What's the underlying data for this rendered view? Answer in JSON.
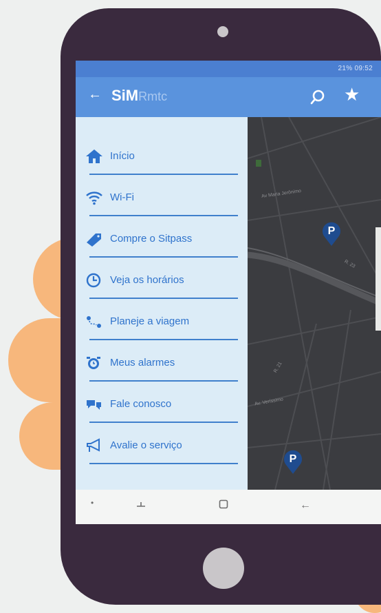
{
  "status_bar": {
    "text": "21% 09:52"
  },
  "app": {
    "logo_main": "SiM",
    "logo_sub": "Rmtc"
  },
  "icons": {
    "back": "back-arrow-icon",
    "search": "search-icon",
    "favorite": "star-icon"
  },
  "drawer": {
    "items": [
      {
        "label": "Início",
        "icon": "home-icon"
      },
      {
        "label": "Wi-Fi",
        "icon": "wifi-icon"
      },
      {
        "label": "Compre o Sitpass",
        "icon": "ticket-icon"
      },
      {
        "label": "Veja os horários",
        "icon": "clock-icon"
      },
      {
        "label": "Planeje a viagem",
        "icon": "route-icon"
      },
      {
        "label": "Meus alarmes",
        "icon": "alarm-icon"
      },
      {
        "label": "Fale conosco",
        "icon": "chat-icon"
      },
      {
        "label": "Avalie o serviço",
        "icon": "megaphone-icon"
      }
    ]
  },
  "map": {
    "streets": [
      "Av Maria Jerônimo",
      "R. 23",
      "R. 21",
      "Av. Veríssimo"
    ],
    "markers": [
      "P",
      "P"
    ]
  },
  "colors": {
    "appbar": "#5a93dd",
    "drawer": "#dcecf7",
    "accent": "#2f73cc",
    "phone": "#3a2a3e",
    "hand": "#f7b77c"
  }
}
